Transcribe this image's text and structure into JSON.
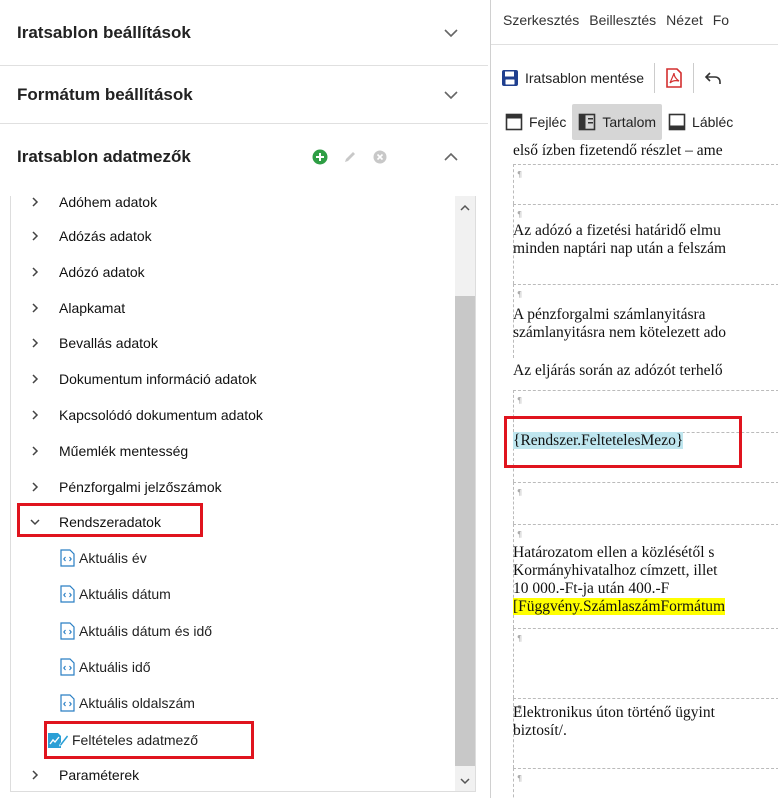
{
  "left_panel": {
    "sections": [
      {
        "title": "Iratsablon beállítások"
      },
      {
        "title": "Formátum beállítások"
      },
      {
        "title": "Iratsablon adatmezők"
      }
    ],
    "tree_partial_top": "Adóhem adatok",
    "tree_items": [
      "Adózás adatok",
      "Adózó adatok",
      "Alapkamat",
      "Bevallás adatok",
      "Dokumentum információ adatok",
      "Kapcsolódó dokumentum adatok",
      "Műemlék mentesség",
      "Pénzforgalmi jelzőszámok"
    ],
    "expanded_item": "Rendszeradatok",
    "children": [
      "Aktuális év",
      "Aktuális dátum",
      "Aktuális dátum és idő",
      "Aktuális idő",
      "Aktuális oldalszám"
    ],
    "selected_child": "Feltételes adatmező",
    "last_item": "Paraméterek"
  },
  "right_panel": {
    "menu": [
      "Szerkesztés",
      "Beillesztés",
      "Nézet",
      "Fo"
    ],
    "toolbar": {
      "save_label": "Iratsablon mentése"
    },
    "tabs": [
      "Fejléc",
      "Tartalom",
      "Lábléc"
    ],
    "doc": {
      "line0": "első ízben fizetendő részlet – ame",
      "p1_l1": "Az adózó a fizetési határidő elmu",
      "p1_l2": "minden naptári nap után a felszám",
      "p2_l1": "A pénzforgalmi számlanyitásra",
      "p2_l2": "számlanyitásra nem kötelezett ado",
      "p3": "Az eljárás során az adózót terhelő",
      "field": "{Rendszer.FeltetelesMezo}",
      "p4_l1": "Határozatom ellen a közlésétől s",
      "p4_l2": "Kormányhivatalhoz címzett, illet",
      "p4_l3": "10 000.-Ft-ja után 400.-F",
      "p4_l4": "[Függvény.SzámlaszámFormátum",
      "p5_l1": "Elektronikus úton történő ügyint",
      "p5_l2": "biztosít/.",
      "para_mark": "¶"
    }
  },
  "colors": {
    "accent_red": "#e0141e",
    "green_add": "#2e9e44",
    "save_blue": "#1f3f8f",
    "pdf_red": "#d32f2f",
    "field_blue": "#bfe6ef",
    "field_yellow": "#ffff00"
  }
}
